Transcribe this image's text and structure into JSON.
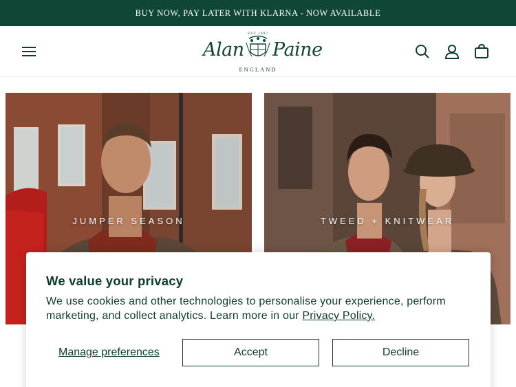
{
  "announcement": "BUY NOW, PAY LATER WITH KLARNA - NOW AVAILABLE",
  "logo": {
    "est": "EST 1907",
    "left_word": "Alan",
    "right_word": "Paine",
    "sub": "ENGLAND"
  },
  "header_icons": [
    "menu-icon",
    "search-icon",
    "account-icon",
    "cart-icon"
  ],
  "tiles": [
    {
      "label": "JUMPER SEASON"
    },
    {
      "label": "TWEED + KNITWEAR"
    }
  ],
  "cookie": {
    "title": "We value your privacy",
    "text": "We use cookies and other technologies to personalise your experience, perform marketing, and collect analytics. Learn more in our ",
    "link": "Privacy Policy.",
    "manage": "Manage preferences",
    "accept": "Accept",
    "decline": "Decline"
  },
  "colors": {
    "brand_green": "#0f4636",
    "text_green": "#0d3b2e"
  }
}
